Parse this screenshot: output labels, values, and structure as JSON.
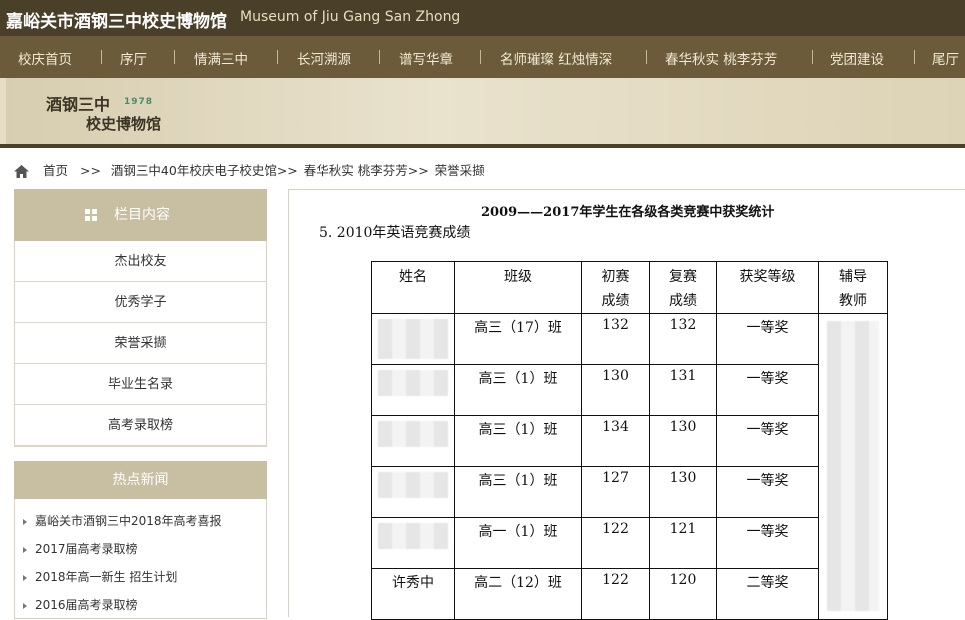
{
  "header": {
    "title_cn": "嘉峪关市酒钢三中校史博物馆",
    "title_en": "Museum of Jiu Gang San Zhong"
  },
  "nav": {
    "items": [
      "校庆首页",
      "序厅",
      "情满三中",
      "长河溯源",
      "谱写华章",
      "名师璀璨 红烛情深",
      "春华秋实 桃李芬芳",
      "党团建设",
      "尾厅"
    ]
  },
  "banner": {
    "logo_line1": "酒钢三中",
    "logo_year": "1978",
    "logo_line2": "校史博物馆"
  },
  "breadcrumb": {
    "items": [
      "首页",
      ">>",
      "酒钢三中40年校庆电子校史馆>>",
      "春华秋实 桃李芬芳>>",
      "荣誉采撷"
    ]
  },
  "sidebar": {
    "header": "栏目内容",
    "items": [
      "杰出校友",
      "优秀学子",
      "荣誉采撷",
      "毕业生名录",
      "高考录取榜"
    ],
    "news_header": "热点新闻",
    "news": [
      "嘉峪关市酒钢三中2018年高考喜报",
      "2017届高考录取榜",
      "2018年高一新生 招生计划",
      "2016届高考录取榜"
    ]
  },
  "content": {
    "title": "2009——2017年学生在各级各类竞赛中获奖统计",
    "subtitle": "5. 2010年英语竞赛成绩",
    "table": {
      "headers": [
        "姓名",
        "班级",
        "初赛\n成绩",
        "复赛\n成绩",
        "获奖等级",
        "辅导\n教师"
      ],
      "rows": [
        {
          "name": "",
          "class": "高三（17）班",
          "prelim": "132",
          "final": "132",
          "award": "一等奖"
        },
        {
          "name": "",
          "class": "高三（1）班",
          "prelim": "130",
          "final": "131",
          "award": "一等奖"
        },
        {
          "name": "",
          "class": "高三（1）班",
          "prelim": "134",
          "final": "130",
          "award": "一等奖"
        },
        {
          "name": "",
          "class": "高三（1）班",
          "prelim": "127",
          "final": "130",
          "award": "一等奖"
        },
        {
          "name": "",
          "class": "高一（1）班",
          "prelim": "122",
          "final": "121",
          "award": "一等奖"
        },
        {
          "name": "许秀中",
          "class": "高二（12）班",
          "prelim": "122",
          "final": "120",
          "award": "二等奖"
        }
      ]
    }
  }
}
